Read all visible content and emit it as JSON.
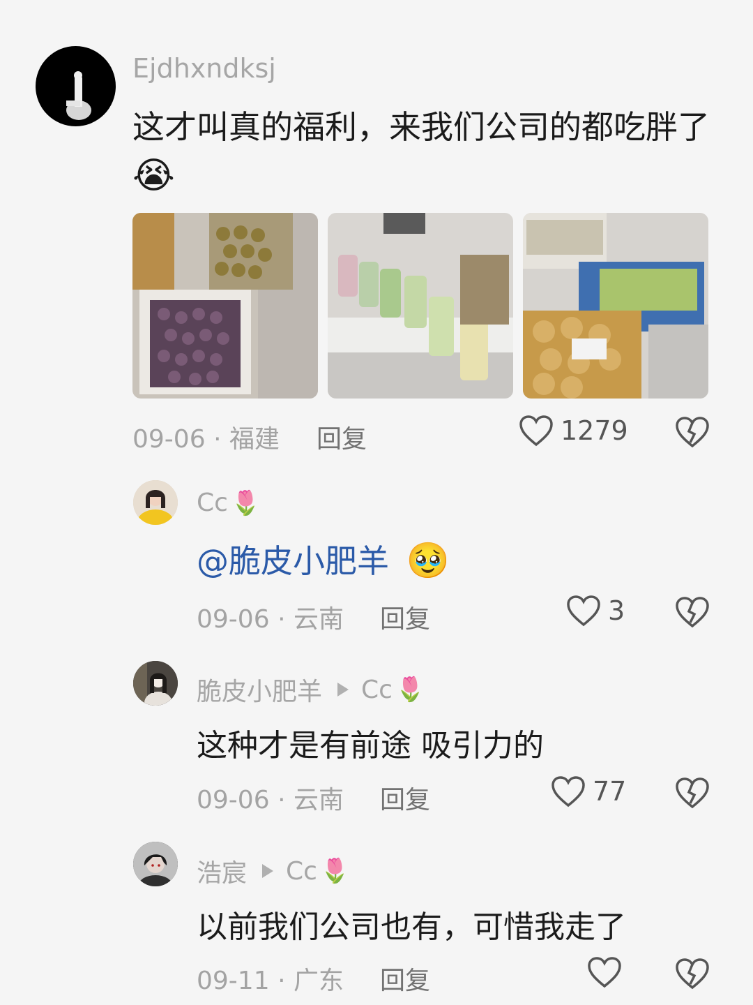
{
  "comments": [
    {
      "username": "Ejdhxndksj",
      "text": "这才叫真的福利，来我们公司的都吃胖了",
      "emoji": "😭",
      "date": "09-06",
      "location": "福建",
      "reply_label": "回复",
      "likes": "1279"
    },
    {
      "username": "Cc",
      "user_emoji": "🌷",
      "mention": "@脆皮小肥羊",
      "emoji": "🥹",
      "date": "09-06",
      "location": "云南",
      "reply_label": "回复",
      "likes": "3"
    },
    {
      "username": "脆皮小肥羊",
      "reply_to": "Cc",
      "reply_to_emoji": "🌷",
      "text": "这种才是有前途 吸引力的",
      "date": "09-06",
      "location": "云南",
      "reply_label": "回复",
      "likes": "77"
    },
    {
      "username": "浩宸",
      "reply_to": "Cc",
      "reply_to_emoji": "🌷",
      "text": "以前我们公司也有，可惜我走了",
      "date": "09-11",
      "location": "广东",
      "reply_label": "回复",
      "likes": ""
    }
  ],
  "separator": "·",
  "colors": {
    "background": "#f5f5f5",
    "text": "#1b1b1b",
    "meta": "#a3a3a3",
    "mention": "#2b5aa8"
  }
}
